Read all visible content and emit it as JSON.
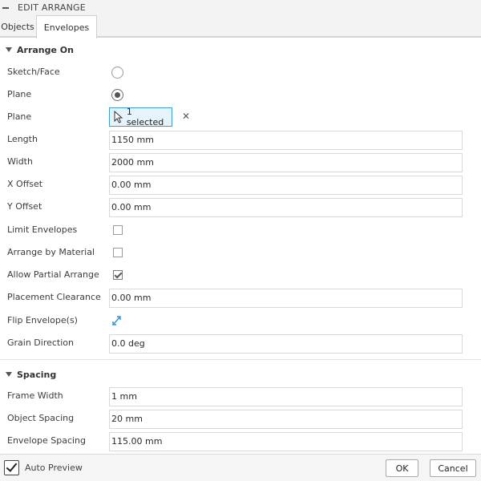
{
  "window": {
    "title": "EDIT ARRANGE"
  },
  "tabs": [
    {
      "label": "Objects",
      "active": false
    },
    {
      "label": "Envelopes",
      "active": true
    }
  ],
  "arrange_on": {
    "header": "Arrange On",
    "sketch_face": {
      "label": "Sketch/Face",
      "checked": false
    },
    "plane_radio": {
      "label": "Plane",
      "checked": true
    },
    "plane_select": {
      "label": "Plane",
      "value": "1 selected",
      "icon": "cursor-arrow-icon"
    },
    "length": {
      "label": "Length",
      "value": "1150 mm"
    },
    "width": {
      "label": "Width",
      "value": "2000 mm"
    },
    "x_offset": {
      "label": "X Offset",
      "value": "0.00 mm"
    },
    "y_offset": {
      "label": "Y Offset",
      "value": "0.00 mm"
    },
    "limit_envelopes": {
      "label": "Limit Envelopes",
      "checked": false
    },
    "arrange_by_material": {
      "label": "Arrange by Material",
      "checked": false
    },
    "allow_partial": {
      "label": "Allow Partial Arrange",
      "checked": true
    },
    "placement_clearance": {
      "label": "Placement Clearance",
      "value": "0.00 mm"
    },
    "flip_envelopes": {
      "label": "Flip Envelope(s)",
      "icon": "flip-arrows-icon"
    },
    "grain_direction": {
      "label": "Grain Direction",
      "value": "0.0 deg"
    }
  },
  "spacing": {
    "header": "Spacing",
    "frame_width": {
      "label": "Frame Width",
      "value": "1 mm"
    },
    "object_spacing": {
      "label": "Object Spacing",
      "value": "20 mm"
    },
    "envelope_spacing": {
      "label": "Envelope Spacing",
      "value": "115.00 mm"
    }
  },
  "footer": {
    "auto_preview": {
      "label": "Auto Preview",
      "checked": true
    },
    "ok_label": "OK",
    "cancel_label": "Cancel"
  },
  "colors": {
    "accent": "#3d9bd6",
    "selection_fill": "#e7f3fb"
  }
}
